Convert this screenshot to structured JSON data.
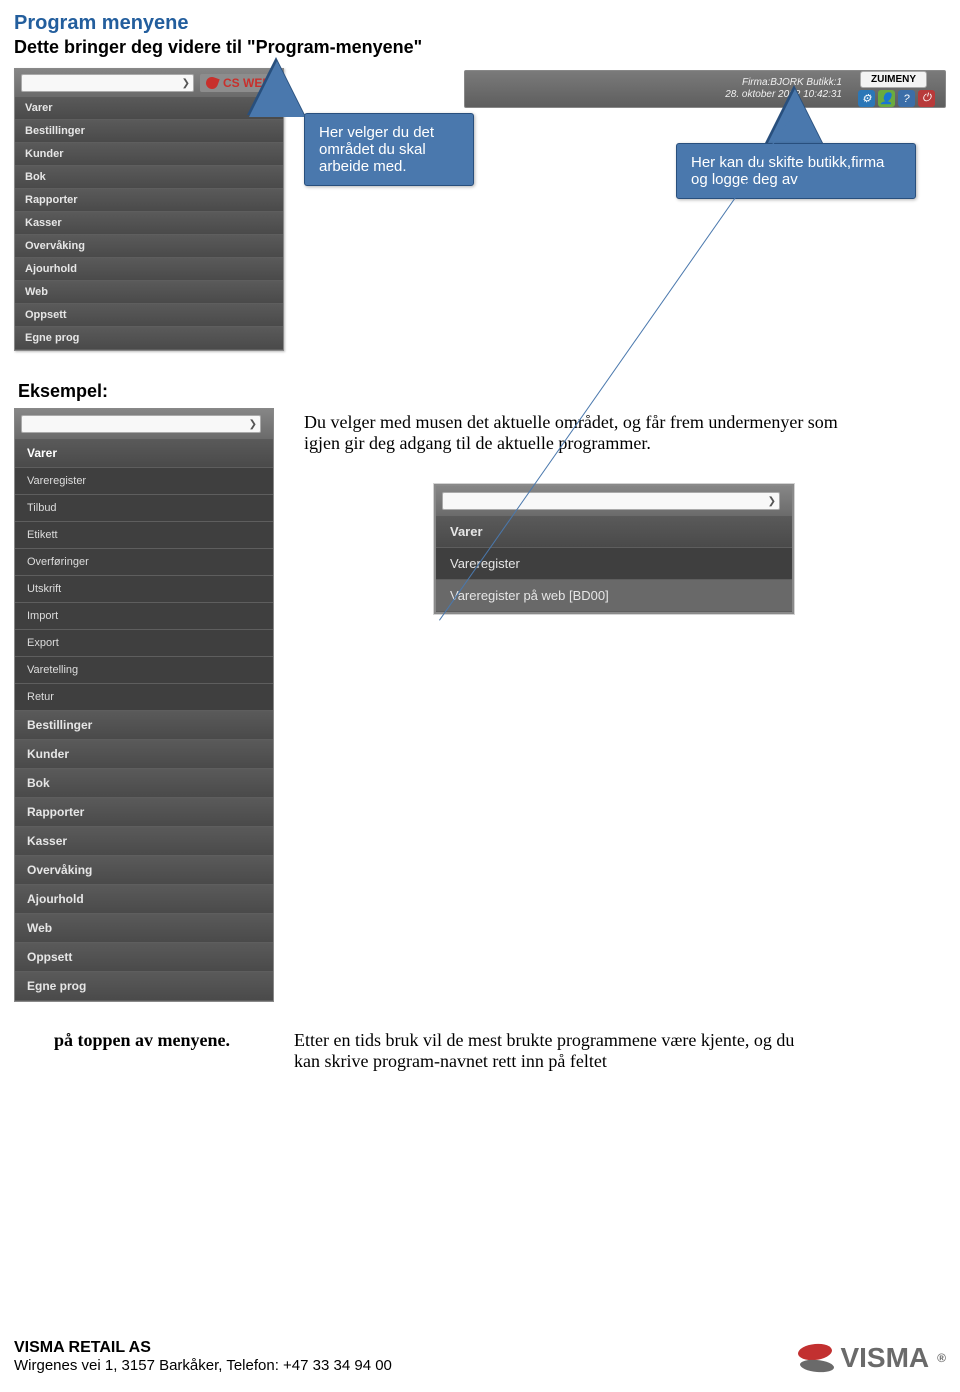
{
  "title": "Program menyene",
  "subtitle": "Dette bringer deg videre til \"Program-menyene\"",
  "brand": "CS WEB",
  "menu_left": {
    "items": [
      "Varer",
      "Bestillinger",
      "Kunder",
      "Bok",
      "Rapporter",
      "Kasser",
      "Overvåking",
      "Ajourhold",
      "Web",
      "Oppsett",
      "Egne prog"
    ]
  },
  "header": {
    "line1": "Firma:BJORK Butikk:1",
    "line2": "28. oktober 2012 10:42:31",
    "button": "ZUIMENY",
    "icons": [
      "gear",
      "user",
      "question",
      "power"
    ]
  },
  "callout_left": "Her velger du det området du skal arbeide med.",
  "callout_right": "Her kan du skifte butikk,firma og logge deg av",
  "eksempel": "Eksempel:",
  "explain": "Du velger med musen det aktuelle området, og får frem undermenyer som igjen gir deg adgang til de aktuelle programmer.",
  "menu_tall": {
    "section0": "Varer",
    "subs": [
      "Vareregister",
      "Tilbud",
      "Etikett",
      "Overføringer",
      "Utskrift",
      "Import",
      "Export",
      "Varetelling",
      "Retur"
    ],
    "rest": [
      "Bestillinger",
      "Kunder",
      "Bok",
      "Rapporter",
      "Kasser",
      "Overvåking",
      "Ajourhold",
      "Web",
      "Oppsett",
      "Egne prog"
    ]
  },
  "mini": {
    "section": "Varer",
    "sub1": "Vareregister",
    "sub2": "Vareregister på web [BD00]"
  },
  "after": "Etter en tids bruk vil de mest brukte programmene være kjente, og du kan skrive program-navnet rett inn på feltet",
  "topline": "på toppen av menyene.",
  "footer": {
    "company": "VISMA RETAIL AS",
    "addr": "Wirgenes vei 1, 3157 Barkåker, Telefon: +47 33 34 94 00",
    "logo": "VISMA"
  }
}
